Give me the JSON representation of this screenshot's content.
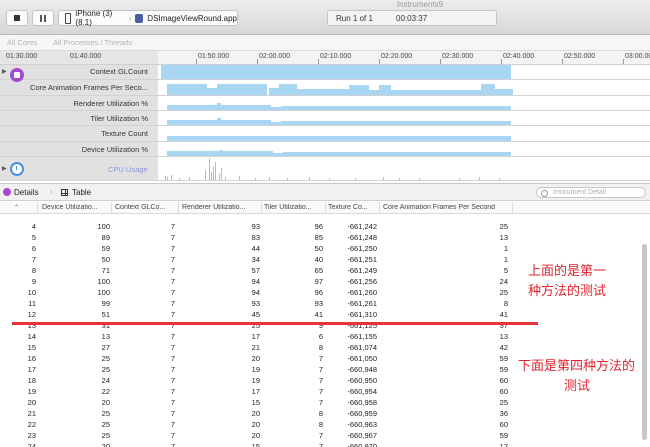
{
  "window": {
    "title": "Instruments9"
  },
  "toolbar": {
    "device": "iPhone (3) (8.1)",
    "app": "DSImageViewRound.app",
    "run_label": "Run 1 of 1",
    "run_time": "00:03:37"
  },
  "scope": {
    "cores": "All Cores",
    "processes": "All Processes / Threads"
  },
  "ruler": {
    "left_ticks": [
      "01:30.000",
      "01:40.000"
    ],
    "ticks": [
      "01:50.000",
      "02:00.000",
      "02:10.000",
      "02:20.000",
      "02:30.000",
      "02:40.000",
      "02:50.000",
      "03:00.000"
    ]
  },
  "tracks": [
    {
      "label": "Context GLCount"
    },
    {
      "label": "Core Animation Frames Per Seco..."
    },
    {
      "label": "Renderer Utilization %"
    },
    {
      "label": "Tiler Utilization %"
    },
    {
      "label": "Texture Count"
    },
    {
      "label": "Device Utilization %"
    }
  ],
  "cpu_track": {
    "label": "CPU Usage"
  },
  "details": {
    "label": "Details",
    "view": "Table",
    "search_placeholder": "Instrument Detail"
  },
  "table": {
    "columns": [
      "Device Utilizatio...",
      "Context GLCo...",
      "Renderer Utilizatio...",
      "Tiler Utilizatio...",
      "Texture Co...",
      "Core Animation Frames Per Second"
    ],
    "rows": [
      [
        "",
        "",
        "",
        "",
        "",
        "",
        ""
      ],
      [
        "4",
        "100",
        "7",
        "93",
        "96",
        "-661,242",
        "25"
      ],
      [
        "5",
        "89",
        "7",
        "83",
        "85",
        "-661,248",
        "13"
      ],
      [
        "6",
        "59",
        "7",
        "44",
        "50",
        "-661,250",
        "1"
      ],
      [
        "7",
        "50",
        "7",
        "34",
        "40",
        "-661,251",
        "1"
      ],
      [
        "8",
        "71",
        "7",
        "57",
        "65",
        "-661,249",
        "5"
      ],
      [
        "9",
        "100",
        "7",
        "94",
        "97",
        "-661,256",
        "24"
      ],
      [
        "10",
        "100",
        "7",
        "94",
        "96",
        "-661,260",
        "25"
      ],
      [
        "11",
        "99",
        "7",
        "93",
        "93",
        "-661,261",
        "8"
      ],
      [
        "12",
        "51",
        "7",
        "45",
        "41",
        "-661,310",
        "41"
      ],
      [
        "13",
        "31",
        "7",
        "25",
        "9",
        "-661,125",
        "37"
      ],
      [
        "14",
        "13",
        "7",
        "17",
        "6",
        "-661,155",
        "13"
      ],
      [
        "15",
        "27",
        "7",
        "21",
        "8",
        "-661,074",
        "42"
      ],
      [
        "16",
        "25",
        "7",
        "20",
        "7",
        "-661,050",
        "59"
      ],
      [
        "17",
        "25",
        "7",
        "19",
        "7",
        "-660,948",
        "59"
      ],
      [
        "18",
        "24",
        "7",
        "19",
        "7",
        "-660,950",
        "60"
      ],
      [
        "19",
        "22",
        "7",
        "17",
        "7",
        "-660,954",
        "60"
      ],
      [
        "20",
        "20",
        "7",
        "15",
        "7",
        "-660,958",
        "25"
      ],
      [
        "21",
        "25",
        "7",
        "20",
        "8",
        "-660,959",
        "36"
      ],
      [
        "22",
        "25",
        "7",
        "20",
        "8",
        "-660,963",
        "60"
      ],
      [
        "23",
        "25",
        "7",
        "20",
        "7",
        "-660,967",
        "59"
      ],
      [
        "24",
        "20",
        "7",
        "15",
        "7",
        "-660,970",
        "12"
      ],
      [
        "25",
        "29",
        "7",
        "23",
        "16",
        "-660,976",
        "41"
      ]
    ]
  },
  "annotations": {
    "top_line1": "上面的是第一",
    "top_line2": "种方法的测试",
    "bottom_line1": "下面是第四种方法的",
    "bottom_line2": "测试"
  },
  "colors": {
    "track_fill": "#a9d6f2",
    "annotation": "#e0242e",
    "instrument_purple": "#a44bd1"
  }
}
